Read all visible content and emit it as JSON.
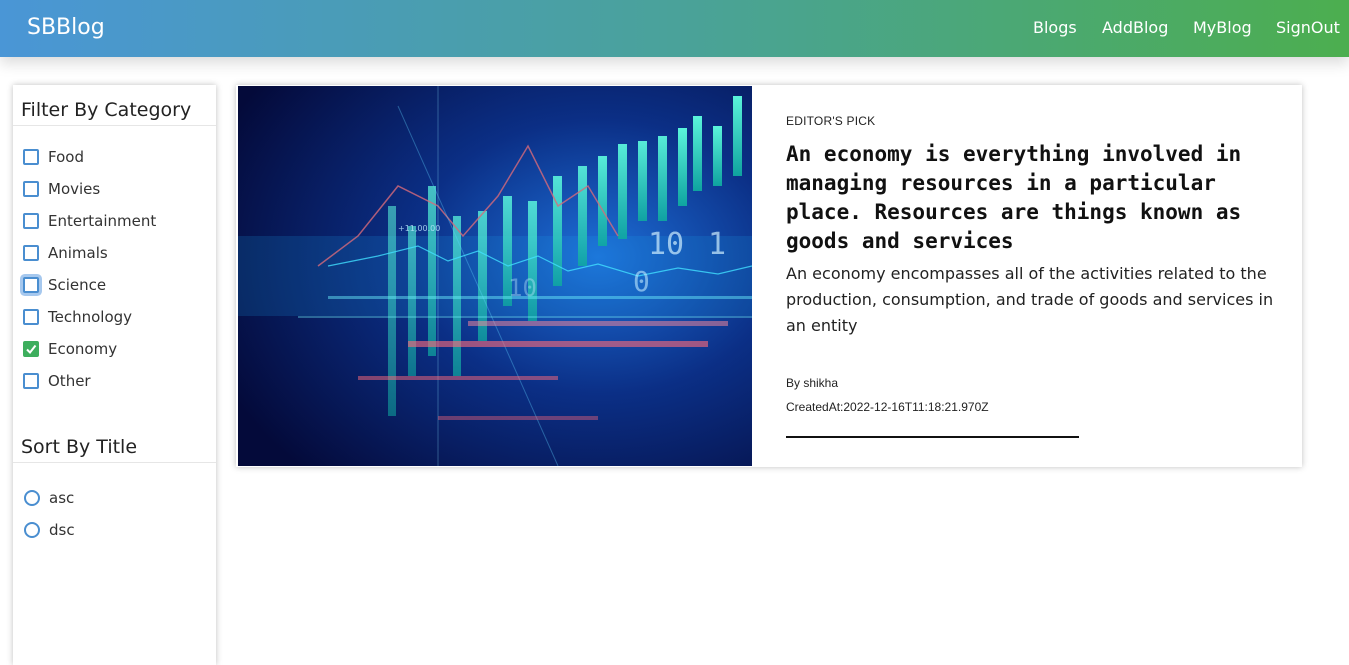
{
  "nav": {
    "brand": "SBBlog",
    "links": [
      "Blogs",
      "AddBlog",
      "MyBlog",
      "SignOut"
    ]
  },
  "sidebar": {
    "filter_heading": "Filter By Category",
    "categories": [
      {
        "label": "Food",
        "checked": false
      },
      {
        "label": "Movies",
        "checked": false
      },
      {
        "label": "Entertainment",
        "checked": false
      },
      {
        "label": "Animals",
        "checked": false
      },
      {
        "label": "Science",
        "checked": false
      },
      {
        "label": "Technology",
        "checked": false
      },
      {
        "label": "Economy",
        "checked": true
      },
      {
        "label": "Other",
        "checked": false
      }
    ],
    "sort_heading": "Sort By Title",
    "sort_options": [
      "asc",
      "dsc"
    ]
  },
  "post": {
    "tag": "EDITOR'S PICK",
    "title": "An economy is everything involved in managing resources in a particular place. Resources are things known as goods and services",
    "description": "An economy encompasses all of the activities related to the production, consumption, and trade of goods and services in an entity",
    "author": "By shikha",
    "created": "CreatedAt:2022-12-16T11:18:21.970Z",
    "image_overlay_text": [
      "10",
      "1",
      "0",
      "10",
      "+11,00.00"
    ]
  },
  "colors": {
    "nav_start": "#4a96d6",
    "nav_end": "#4cae4f",
    "checkbox_border": "#4a8ed0",
    "checkbox_checked": "#3dae5d"
  }
}
